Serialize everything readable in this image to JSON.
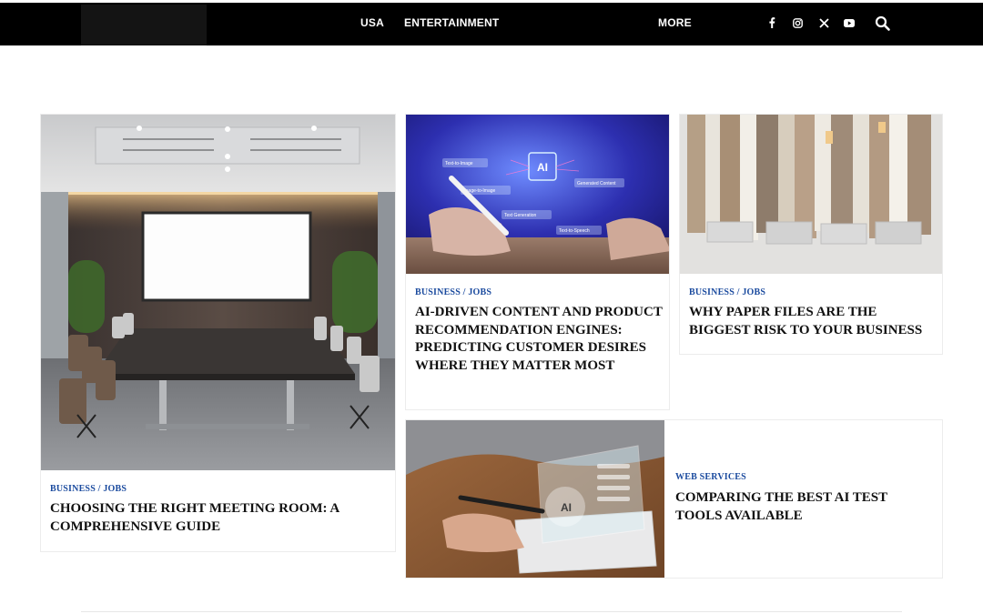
{
  "nav": {
    "items": [
      {
        "label": "USA"
      },
      {
        "label": "ENTERTAINMENT"
      },
      {
        "label": "MORE"
      }
    ],
    "social_icons": [
      "facebook-icon",
      "instagram-icon",
      "x-icon",
      "youtube-icon"
    ],
    "search_icon": "search-icon",
    "bar_color": "#000000"
  },
  "cards": [
    {
      "category": "BUSINESS / JOBS",
      "title": "CHOOSING THE RIGHT MEETING ROOM: A COMPREHENSIVE GUIDE",
      "image": "conference-room-photo"
    },
    {
      "category": "BUSINESS / JOBS",
      "title": "AI-DRIVEN CONTENT AND PRODUCT RECOMMENDATION ENGINES: PREDICTING CUSTOMER DESIRES WHERE THEY MATTER MOST",
      "image": "ai-tablet-photo",
      "image_labels": {
        "text_to_image": "Text-to-Image",
        "image_to_image": "Image-to-Image",
        "generated_content": "Generated Content",
        "text_to_speech": "Text-to-Speech",
        "text_generation": "Text Generation",
        "chip": "AI"
      }
    },
    {
      "category": "BUSINESS / JOBS",
      "title": "WHY PAPER FILES ARE THE BIGGEST RISK TO YOUR BUSINESS",
      "image": "paper-files-photo"
    },
    {
      "category": "WEB SERVICES",
      "title": "COMPARING THE BEST AI TEST TOOLS AVAILABLE",
      "image": "ai-hologram-photo",
      "image_labels": {
        "chip": "AI"
      }
    }
  ],
  "colors": {
    "category": "#1a4a9e",
    "title": "#111111"
  }
}
